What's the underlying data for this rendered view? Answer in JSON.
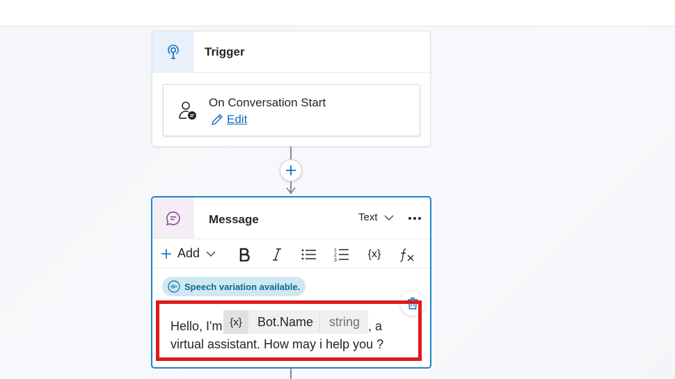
{
  "trigger": {
    "title": "Trigger",
    "event": {
      "title": "On Conversation Start",
      "edit_label": "Edit"
    }
  },
  "message": {
    "title": "Message",
    "type_dropdown": "Text",
    "toolbar": {
      "add_label": "Add",
      "variable_label": "{x}"
    },
    "speech_badge": "Speech variation available.",
    "content": {
      "prefix": "Hello, I'm",
      "variable": {
        "icon_label": "{x}",
        "name": "Bot.Name",
        "type": "string"
      },
      "after_variable": ", a",
      "second_line": "virtual assistant. How may i help you ?"
    }
  },
  "colors": {
    "accent_blue": "#1a86c7",
    "link_blue": "#0f6cbd",
    "highlight_red": "#e0191b",
    "speech_badge_bg": "#cfe8f2",
    "message_icon_bg": "#f5edf6",
    "trigger_icon_bg": "#e8f1fb"
  }
}
